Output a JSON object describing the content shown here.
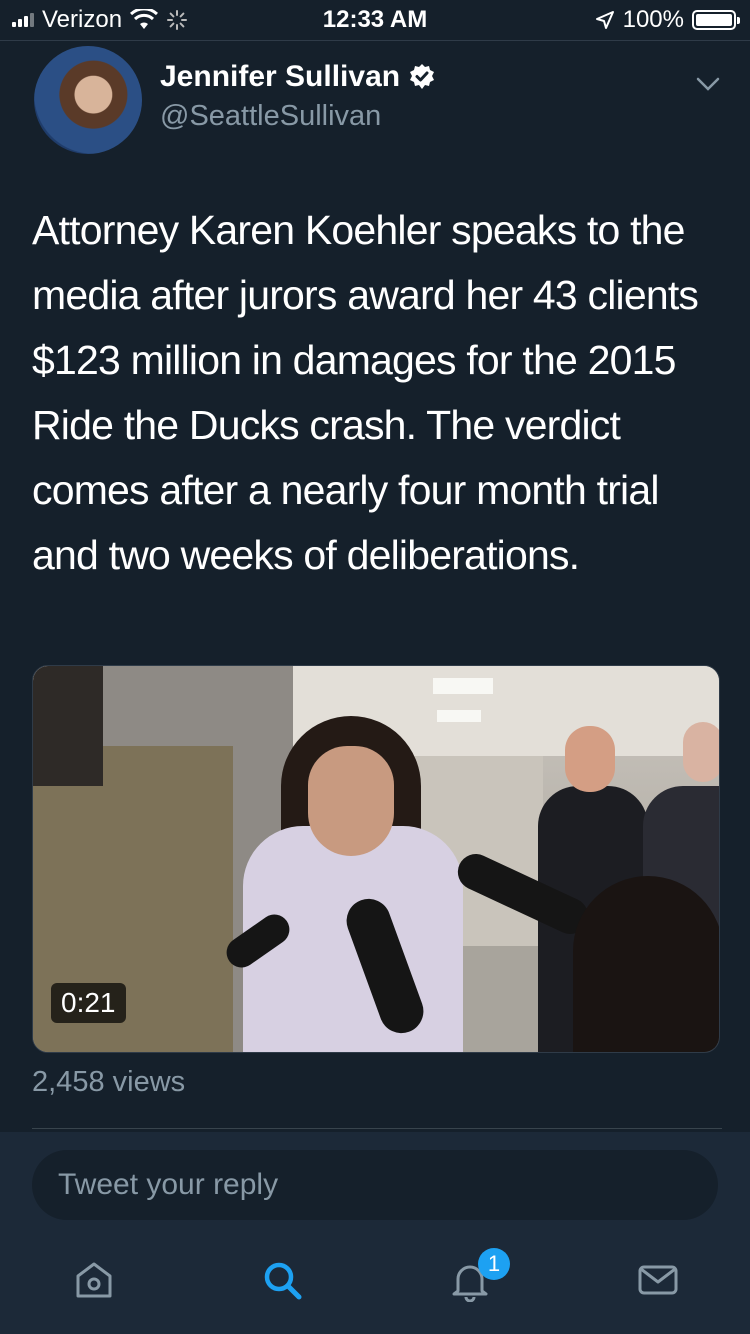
{
  "status_bar": {
    "carrier": "Verizon",
    "time": "12:33 AM",
    "battery": "100%"
  },
  "tweet": {
    "author_name": "Jennifer Sullivan",
    "author_handle": "@SeattleSullivan",
    "verified": true,
    "text": "Attorney Karen Koehler speaks to the media after jurors award her 43 clients $123 million in damages for the 2015 Ride the Ducks crash. The verdict comes after a nearly four month trial and two weeks of deliberations.",
    "video_duration": "0:21",
    "views": "2,458 views"
  },
  "reply": {
    "placeholder": "Tweet your reply"
  },
  "tab_bar": {
    "tabs": [
      "home-icon",
      "search-icon",
      "notifications-icon",
      "messages-icon"
    ],
    "active": "search-icon",
    "notification_count": "1"
  },
  "colors": {
    "background": "#15202b",
    "accent": "#1da1f2",
    "secondary_text": "#8899a6"
  }
}
